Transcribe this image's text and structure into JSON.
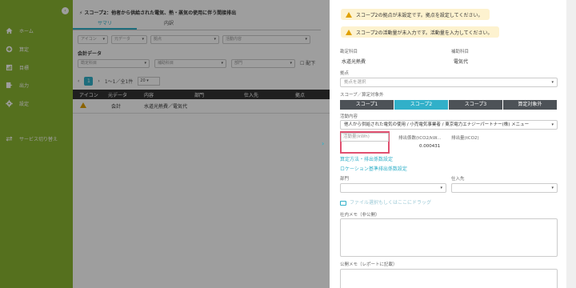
{
  "sidebar": {
    "items": [
      {
        "label": "ホーム",
        "icon": "home-icon"
      },
      {
        "label": "算定",
        "icon": "calculator-icon"
      },
      {
        "label": "目標",
        "icon": "target-icon"
      },
      {
        "label": "出力",
        "icon": "export-icon"
      },
      {
        "label": "設定",
        "icon": "gear-icon"
      }
    ],
    "service_switch": "サービス切り替え"
  },
  "main": {
    "title": "スコープ2：他者から供給された電気、熱・蒸気の使用に伴う間接排出",
    "tabs": [
      "サマリ",
      "内訳"
    ],
    "filters": [
      "アイコン",
      "元データ",
      "拠点",
      "活動内容"
    ],
    "section_title": "会計データ",
    "filters2": [
      "勘定科目",
      "補助科目",
      "部門",
      "配下"
    ],
    "pager": {
      "page": "1",
      "range": "1〜1／全1件",
      "page_size": "20"
    },
    "table": {
      "headers": [
        "アイコン",
        "元データ",
        "内容",
        "部門",
        "仕入先",
        "拠点"
      ],
      "row": {
        "source": "会計",
        "content": "水道光熱費／電気代"
      }
    }
  },
  "panel": {
    "alerts": [
      "スコープ2の拠点が未設定です。拠点を設定してください。",
      "スコープ2の活動量が未入力です。活動量を入力してください。"
    ],
    "account_label": "勘定科目",
    "account_value": "水道光熱費",
    "sub_account_label": "補助科目",
    "sub_account_value": "電気代",
    "site_label": "拠点",
    "site_placeholder": "拠点を選択",
    "scope_label": "スコープ／算定対象外",
    "scope_tabs": [
      "スコープ1",
      "スコープ2",
      "スコープ3",
      "算定対象外"
    ],
    "activity_label": "活動内容",
    "activity_value": "他人から供給された電気の使用 / 小売電気事業者 / 東京電力エナジーパートナー(株) メニュー",
    "amount_placeholder": "活動量(kWh)",
    "factor_label": "排出係数(tCO2/kW...",
    "factor_value": "0.000431",
    "emission_label": "排出量(tCO2)",
    "link_method": "算定方法・排出係数設定",
    "link_location": "ロケーション基準排出係数設定",
    "dept_label": "部門",
    "supplier_label": "仕入先",
    "file_drop": "ファイル選択もしくはここにドラッグ",
    "internal_memo_label": "社内メモ（非公開）",
    "public_memo_label": "公開メモ（レポートに記載）"
  },
  "colors": {
    "sidebar": "#8ab531",
    "accent": "#31b0c9",
    "alert_bg": "#fdf2cf",
    "highlight": "#e05070"
  }
}
